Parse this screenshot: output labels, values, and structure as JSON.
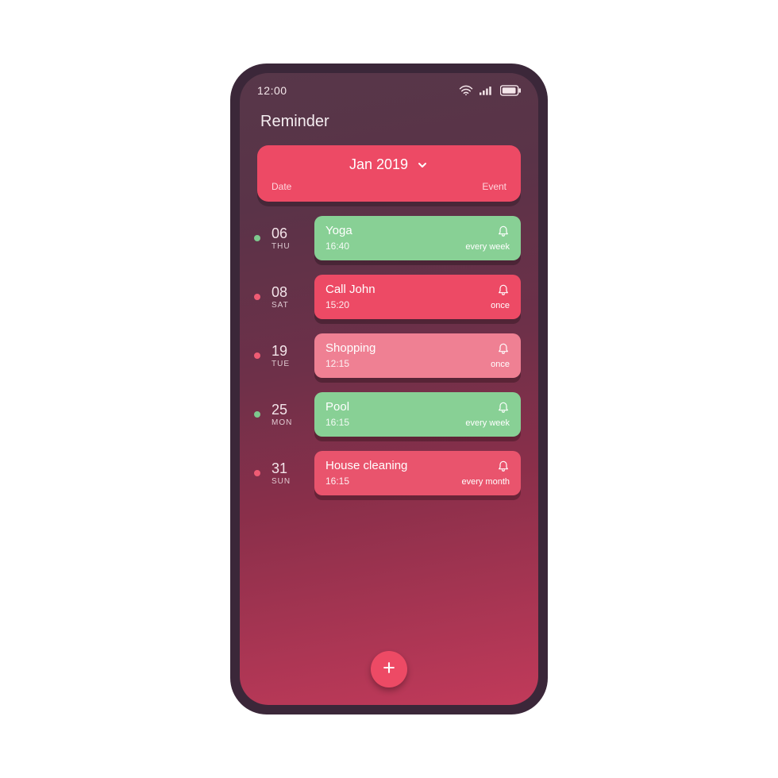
{
  "status": {
    "time": "12:00"
  },
  "header": {
    "title": "Reminder"
  },
  "month": {
    "label": "Jan 2019",
    "date_label": "Date",
    "event_label": "Event"
  },
  "colors": {
    "green": "#88d095",
    "pink": "#ed4a65",
    "light_pink": "#ef8093"
  },
  "reminders": [
    {
      "day": "06",
      "dow": "THU",
      "dot": "green",
      "card": "green",
      "title": "Yoga",
      "time": "16:40",
      "repeat": "every week"
    },
    {
      "day": "08",
      "dow": "SAT",
      "dot": "pink",
      "card": "pink",
      "title": "Call John",
      "time": "15:20",
      "repeat": "once"
    },
    {
      "day": "19",
      "dow": "TUE",
      "dot": "pink",
      "card": "lpink",
      "title": "Shopping",
      "time": "12:15",
      "repeat": "once"
    },
    {
      "day": "25",
      "dow": "MON",
      "dot": "green",
      "card": "green",
      "title": "Pool",
      "time": "16:15",
      "repeat": "every week"
    },
    {
      "day": "31",
      "dow": "SUN",
      "dot": "pink",
      "card": "pink2",
      "title": "House cleaning",
      "time": "16:15",
      "repeat": "every month"
    }
  ]
}
